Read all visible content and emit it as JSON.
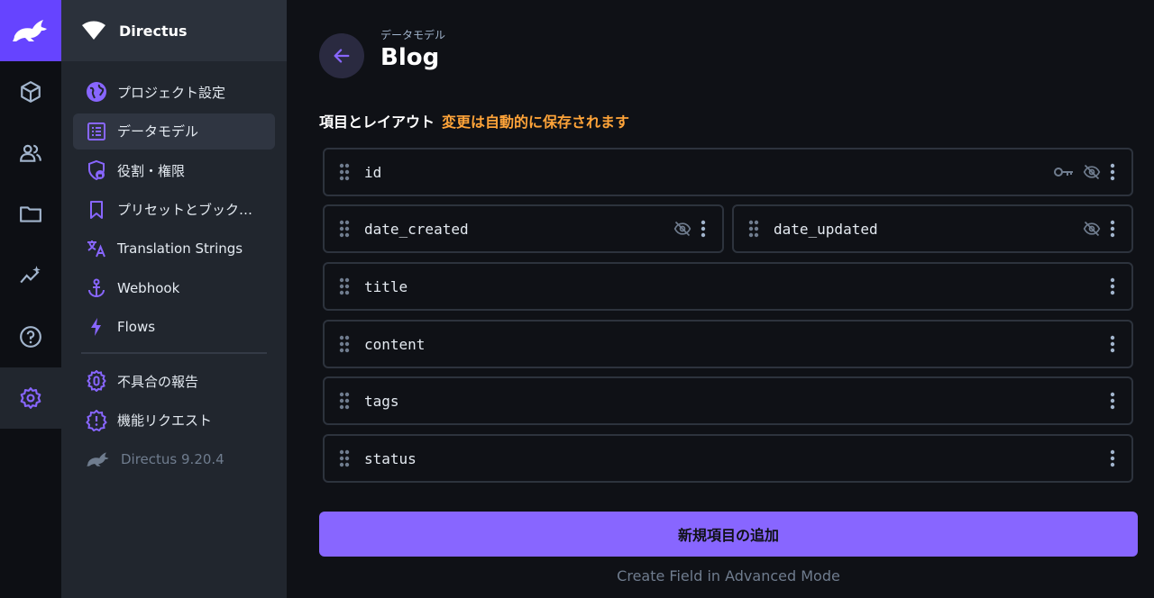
{
  "project": {
    "name": "Directus"
  },
  "module_bar": {
    "modules": [
      {
        "icon": "box-icon",
        "name": "content"
      },
      {
        "icon": "users-icon",
        "name": "users"
      },
      {
        "icon": "folder-icon",
        "name": "files"
      },
      {
        "icon": "insights-icon",
        "name": "insights"
      },
      {
        "icon": "help-icon",
        "name": "help"
      },
      {
        "icon": "gear-icon",
        "name": "settings",
        "active": true
      }
    ]
  },
  "nav": {
    "items": [
      {
        "label": "プロジェクト設定",
        "icon": "globe-icon"
      },
      {
        "label": "データモデル",
        "icon": "list-icon",
        "active": true
      },
      {
        "label": "役割・権限",
        "icon": "shield-icon"
      },
      {
        "label": "プリセットとブック…",
        "icon": "bookmark-icon"
      },
      {
        "label": "Translation Strings",
        "icon": "translate-icon"
      },
      {
        "label": "Webhook",
        "icon": "anchor-icon"
      },
      {
        "label": "Flows",
        "icon": "bolt-icon"
      }
    ],
    "secondary": [
      {
        "label": "不具合の報告",
        "icon": "bug-icon"
      },
      {
        "label": "機能リクエスト",
        "icon": "alert-badge-icon"
      }
    ],
    "version": "Directus 9.20.4"
  },
  "header": {
    "breadcrumb": "データモデル",
    "title": "Blog"
  },
  "section": {
    "title": "項目とレイアウト",
    "note": "変更は自動的に保存されます"
  },
  "fields": [
    {
      "name": "id",
      "icons": [
        "key-icon",
        "eye-off-icon",
        "more-vert-icon"
      ]
    },
    {
      "name": "date_created",
      "icons": [
        "eye-off-icon",
        "more-vert-icon"
      ]
    },
    {
      "name": "date_updated",
      "icons": [
        "eye-off-icon",
        "more-vert-icon"
      ]
    },
    {
      "name": "title",
      "icons": [
        "more-vert-icon"
      ]
    },
    {
      "name": "content",
      "icons": [
        "more-vert-icon"
      ]
    },
    {
      "name": "tags",
      "icons": [
        "more-vert-icon"
      ]
    },
    {
      "name": "status",
      "icons": [
        "more-vert-icon"
      ]
    }
  ],
  "actions": {
    "add_field": "新規項目の追加",
    "advanced": "Create Field in Advanced Mode"
  },
  "colors": {
    "accent": "#6644ff",
    "accent_light": "#8866ff",
    "warning": "#ffa439",
    "background": "#0f1116"
  }
}
